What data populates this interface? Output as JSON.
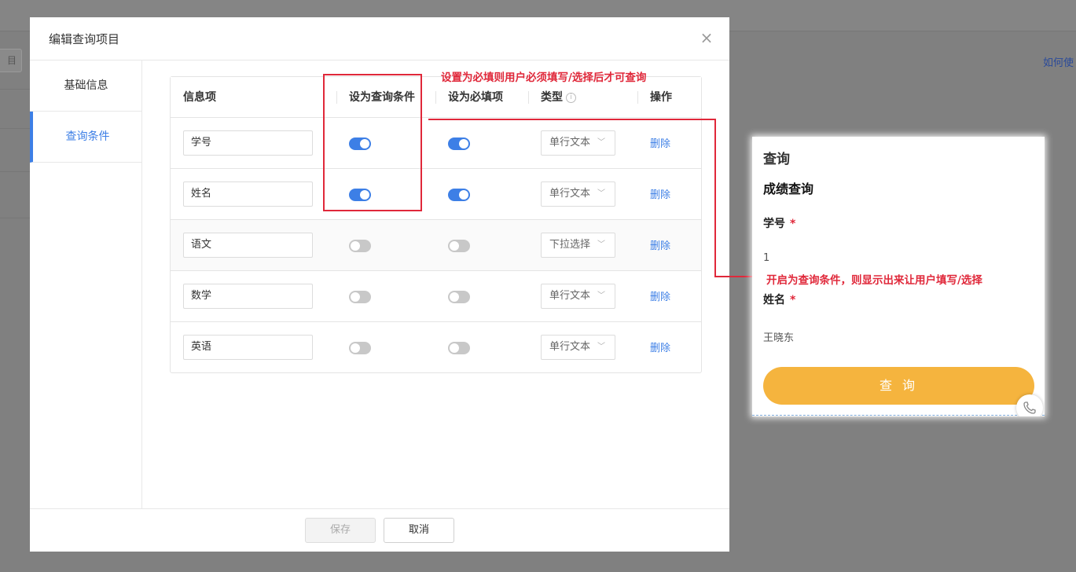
{
  "background": {
    "button_label": "目",
    "help_link": "如何使"
  },
  "modal": {
    "title": "编辑查询项目",
    "close_icon": "×",
    "nav": [
      {
        "label": "基础信息"
      },
      {
        "label": "查询条件"
      }
    ],
    "table": {
      "headers": {
        "field": "信息项",
        "as_query": "设为查询条件",
        "as_required": "设为必填项",
        "type": "类型",
        "type_info_icon": "i",
        "action": "操作"
      },
      "rows": [
        {
          "name": "学号",
          "query": true,
          "required": true,
          "type": "单行文本",
          "action": "删除"
        },
        {
          "name": "姓名",
          "query": true,
          "required": true,
          "type": "单行文本",
          "action": "删除"
        },
        {
          "name": "语文",
          "query": false,
          "required": false,
          "type": "下拉选择",
          "action": "删除"
        },
        {
          "name": "数学",
          "query": false,
          "required": false,
          "type": "单行文本",
          "action": "删除"
        },
        {
          "name": "英语",
          "query": false,
          "required": false,
          "type": "单行文本",
          "action": "删除"
        }
      ]
    },
    "footer": {
      "save_label": "保存",
      "cancel_label": "取消"
    }
  },
  "annotations": {
    "required_note": "设置为必填则用户必须填写/选择后才可查询",
    "query_note": "开启为查询条件，则显示出来让用户填写/选择",
    "color": "#e0283a"
  },
  "preview": {
    "title": "查询",
    "subtitle": "成绩查询",
    "fields": [
      {
        "label": "学号",
        "required_mark": "*",
        "value": "1"
      },
      {
        "label": "姓名",
        "required_mark": "*",
        "value": "王晓东"
      }
    ],
    "button_label": "查 询",
    "button_color": "#f5b43e"
  },
  "colors": {
    "accent": "#3d7fe6",
    "toggle_off": "#c8c8c8"
  }
}
